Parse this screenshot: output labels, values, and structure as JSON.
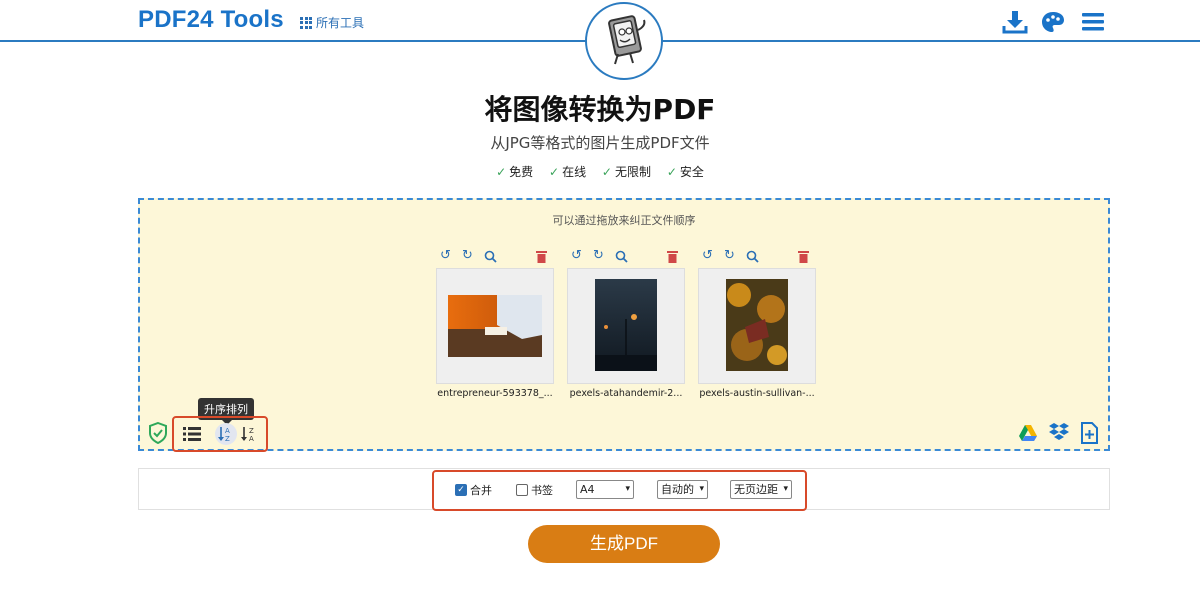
{
  "header": {
    "brand": "PDF24 Tools",
    "all_tools": "所有工具"
  },
  "hero": {
    "title": "将图像转换为PDF",
    "subtitle": "从JPG等格式的图片生成PDF文件",
    "features": [
      "免费",
      "在线",
      "无限制",
      "安全"
    ]
  },
  "dropzone": {
    "hint": "可以通过拖放来纠正文件顺序",
    "files": [
      {
        "name": "entrepreneur-593378_..."
      },
      {
        "name": "pexels-atahandemir-2..."
      },
      {
        "name": "pexels-austin-sullivan-..."
      }
    ],
    "tooltip": "升序排列"
  },
  "options": {
    "merge_label": "合并",
    "merge_checked": true,
    "bookmark_label": "书签",
    "bookmark_checked": false,
    "page_size": "A4",
    "orientation": "自动的",
    "margin": "无页边距"
  },
  "actions": {
    "generate": "生成PDF"
  },
  "colors": {
    "accent": "#1a73c8",
    "button": "#d97d14",
    "highlight": "#d84a2a",
    "dropzone_bg": "#fdf7d8"
  }
}
